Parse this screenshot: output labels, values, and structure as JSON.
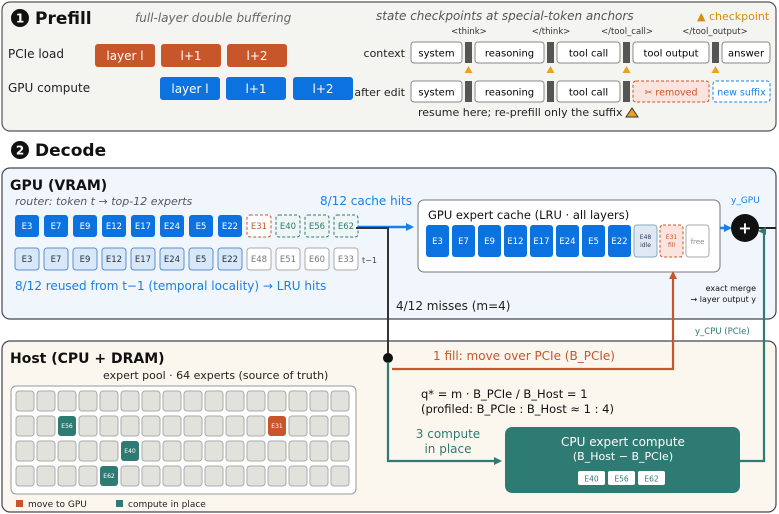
{
  "prefill": {
    "number": "1",
    "title": "Prefill",
    "subtitle": "full-layer double buffering",
    "checkpoint_note": "state checkpoints at special-token anchors",
    "checkpoint_legend": "▲ checkpoint",
    "pcie_label": "PCIe load",
    "gpu_label": "GPU compute",
    "pcie_blocks": [
      "layer l",
      "l+1",
      "l+2"
    ],
    "gpu_blocks": [
      "layer l",
      "l+1",
      "l+2"
    ],
    "tags": [
      "<think>",
      "</think>",
      "</tool_call>",
      "</tool_output>"
    ],
    "context_label": "context",
    "context_segments": [
      "system",
      "reasoning",
      "tool call",
      "tool output",
      "answer"
    ],
    "edit_label": "after edit",
    "edit_segments": [
      "system",
      "reasoning",
      "tool call"
    ],
    "removed_label": "✂ removed",
    "new_suffix_label": "new suffix",
    "resume_note": "resume here; re-prefill only the suffix"
  },
  "decode": {
    "number": "2",
    "title": "Decode"
  },
  "gpu_panel": {
    "title": "GPU (VRAM)",
    "router_note": "router: token t → top-12 experts",
    "hits_note": "8/12 cache hits",
    "row_t": {
      "hits": [
        "E3",
        "E7",
        "E9",
        "E12",
        "E17",
        "E24",
        "E5",
        "E22"
      ],
      "fill": "E31",
      "in_place": [
        "E40",
        "E56",
        "E62"
      ]
    },
    "row_prev": {
      "hits": [
        "E3",
        "E7",
        "E9",
        "E12",
        "E17",
        "E24",
        "E5",
        "E22"
      ],
      "others": [
        "E48",
        "E51",
        "E60",
        "E33"
      ],
      "label": "t−1"
    },
    "reuse_note": "8/12 reused from t−1 (temporal locality) → LRU hits",
    "cache_title": "GPU expert cache (LRU · all layers)",
    "cache_blocks": [
      "E3",
      "E7",
      "E9",
      "E12",
      "E17",
      "E24",
      "E5",
      "E22"
    ],
    "idle_label": [
      "E48",
      "idle"
    ],
    "fill_label": [
      "E31",
      "fill"
    ],
    "free_label": "free",
    "y_gpu": "y_GPU",
    "merge_note": [
      "exact merge",
      "→ layer output y"
    ],
    "misses_note": "4/12 misses (m=4)",
    "y_cpu": "y_CPU (PCIe)"
  },
  "host_panel": {
    "title": "Host (CPU + DRAM)",
    "pool_note": "expert pool · 64 experts (source of truth)",
    "pool_highlights": [
      {
        "index": 18,
        "label": "E56",
        "kind": "compute"
      },
      {
        "index": 28,
        "label": "E31",
        "kind": "move"
      },
      {
        "index": 37,
        "label": "E40",
        "kind": "compute"
      },
      {
        "index": 52,
        "label": "E62",
        "kind": "compute"
      }
    ],
    "legend_move": "move to GPU",
    "legend_compute": "compute in place",
    "fill_note": "1 fill: move over PCIe (B_PCIe)",
    "formula": "q* = m · B_PCIe / B_Host = 1",
    "profiled": "(profiled: B_PCIe : B_Host ≈ 1 : 4)",
    "compute_note": [
      "3 compute",
      "in place"
    ],
    "cpu_title": "CPU expert compute",
    "cpu_sub": "(B_Host − B_PCIe)",
    "cpu_experts": [
      "E40",
      "E56",
      "E62"
    ]
  },
  "colors": {
    "orange": "#c7562b",
    "blue": "#0b72e0",
    "teal": "#2e7b73",
    "gpu_bg": "#f1f6fc",
    "host_bg": "#fbf6ee",
    "prefill_bg": "#f4f4f0",
    "checkpoint": "#f0a020"
  }
}
